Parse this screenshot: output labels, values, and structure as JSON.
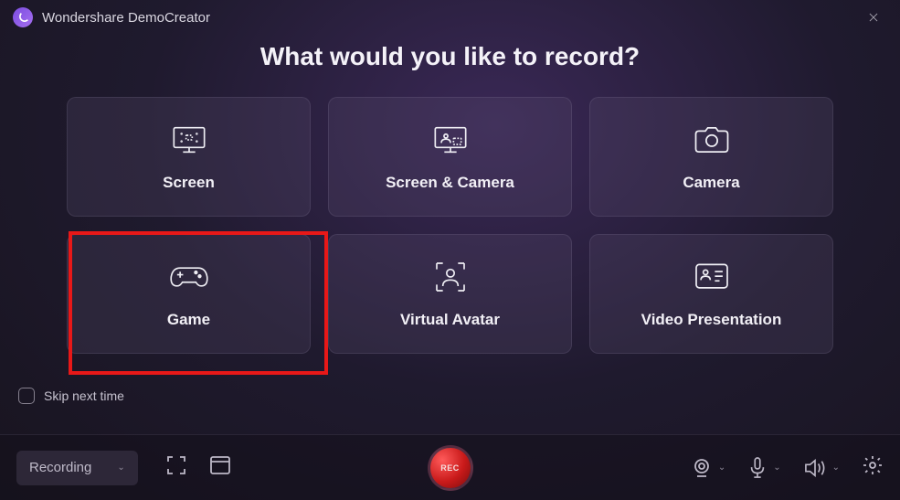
{
  "titlebar": {
    "app_title": "Wondershare DemoCreator"
  },
  "heading": "What would you like to record?",
  "cards": {
    "screen": {
      "label": "Screen"
    },
    "screen_camera": {
      "label": "Screen & Camera"
    },
    "camera": {
      "label": "Camera"
    },
    "game": {
      "label": "Game"
    },
    "virtual_avatar": {
      "label": "Virtual Avatar"
    },
    "video_presentation": {
      "label": "Video Presentation"
    }
  },
  "footer": {
    "skip_label": "Skip next time"
  },
  "toolbar": {
    "recording_label": "Recording",
    "rec_label": "REC"
  },
  "highlighted_card": "game"
}
